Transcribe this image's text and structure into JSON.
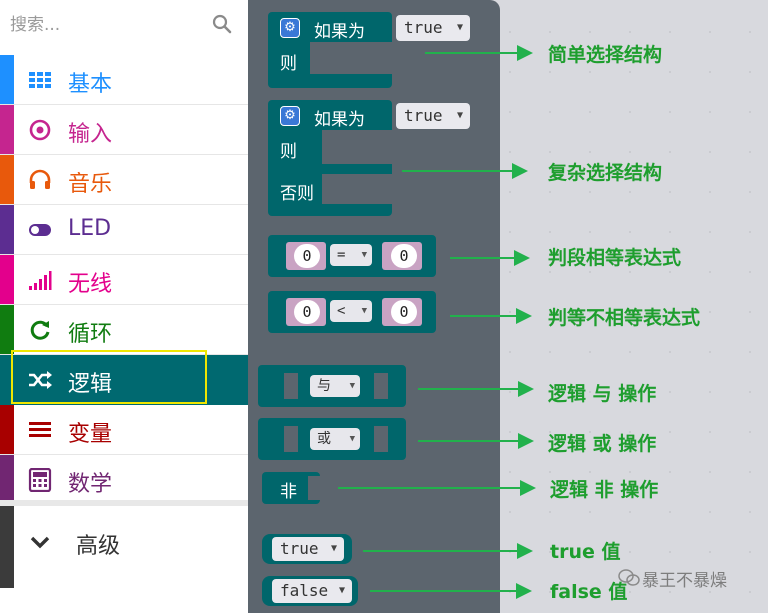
{
  "search": {
    "placeholder": "搜索..."
  },
  "sidebar": {
    "categories": [
      {
        "label": "基本",
        "color": "#1e90ff",
        "icon": "grid-icon"
      },
      {
        "label": "输入",
        "color": "#c5258f",
        "icon": "target-icon"
      },
      {
        "label": "音乐",
        "color": "#e8590c",
        "icon": "headphones-icon"
      },
      {
        "label": "LED",
        "color": "#5c2d91",
        "icon": "toggle-icon"
      },
      {
        "label": "无线",
        "color": "#e3008c",
        "icon": "signal-icon"
      },
      {
        "label": "循环",
        "color": "#107c10",
        "icon": "refresh-icon"
      },
      {
        "label": "逻辑",
        "color": "#006970",
        "icon": "shuffle-icon"
      },
      {
        "label": "变量",
        "color": "#a80000",
        "icon": "lines-icon"
      },
      {
        "label": "数学",
        "color": "#712672",
        "icon": "calculator-icon"
      }
    ],
    "advanced": {
      "label": "高级",
      "color": "#3b3b3b",
      "icon": "chevron-down-icon"
    }
  },
  "flyout": {
    "if_label": "如果为",
    "then_label": "则",
    "else_label": "否则",
    "true_value": "true",
    "false_value": "false",
    "zero": "0",
    "eq_op": "=",
    "lt_op": "<",
    "and_op": "与",
    "or_op": "或",
    "not_label": "非"
  },
  "annotations": {
    "simple_if": "简单选择结构",
    "complex_if": "复杂选择结构",
    "equal_expr": "判段相等表达式",
    "not_equal_expr": "判等不相等表达式",
    "and_op": "逻辑 与 操作",
    "or_op": "逻辑 或 操作",
    "not_op": "逻辑 非 操作",
    "true_val": "true 值",
    "false_val": "false 值"
  },
  "watermark": "暴王不暴燥",
  "colors": {
    "logic_block": "#00666b",
    "flyout_bg": "#5c656e",
    "annotation": "#22b14c",
    "selection": "#f0e600"
  }
}
